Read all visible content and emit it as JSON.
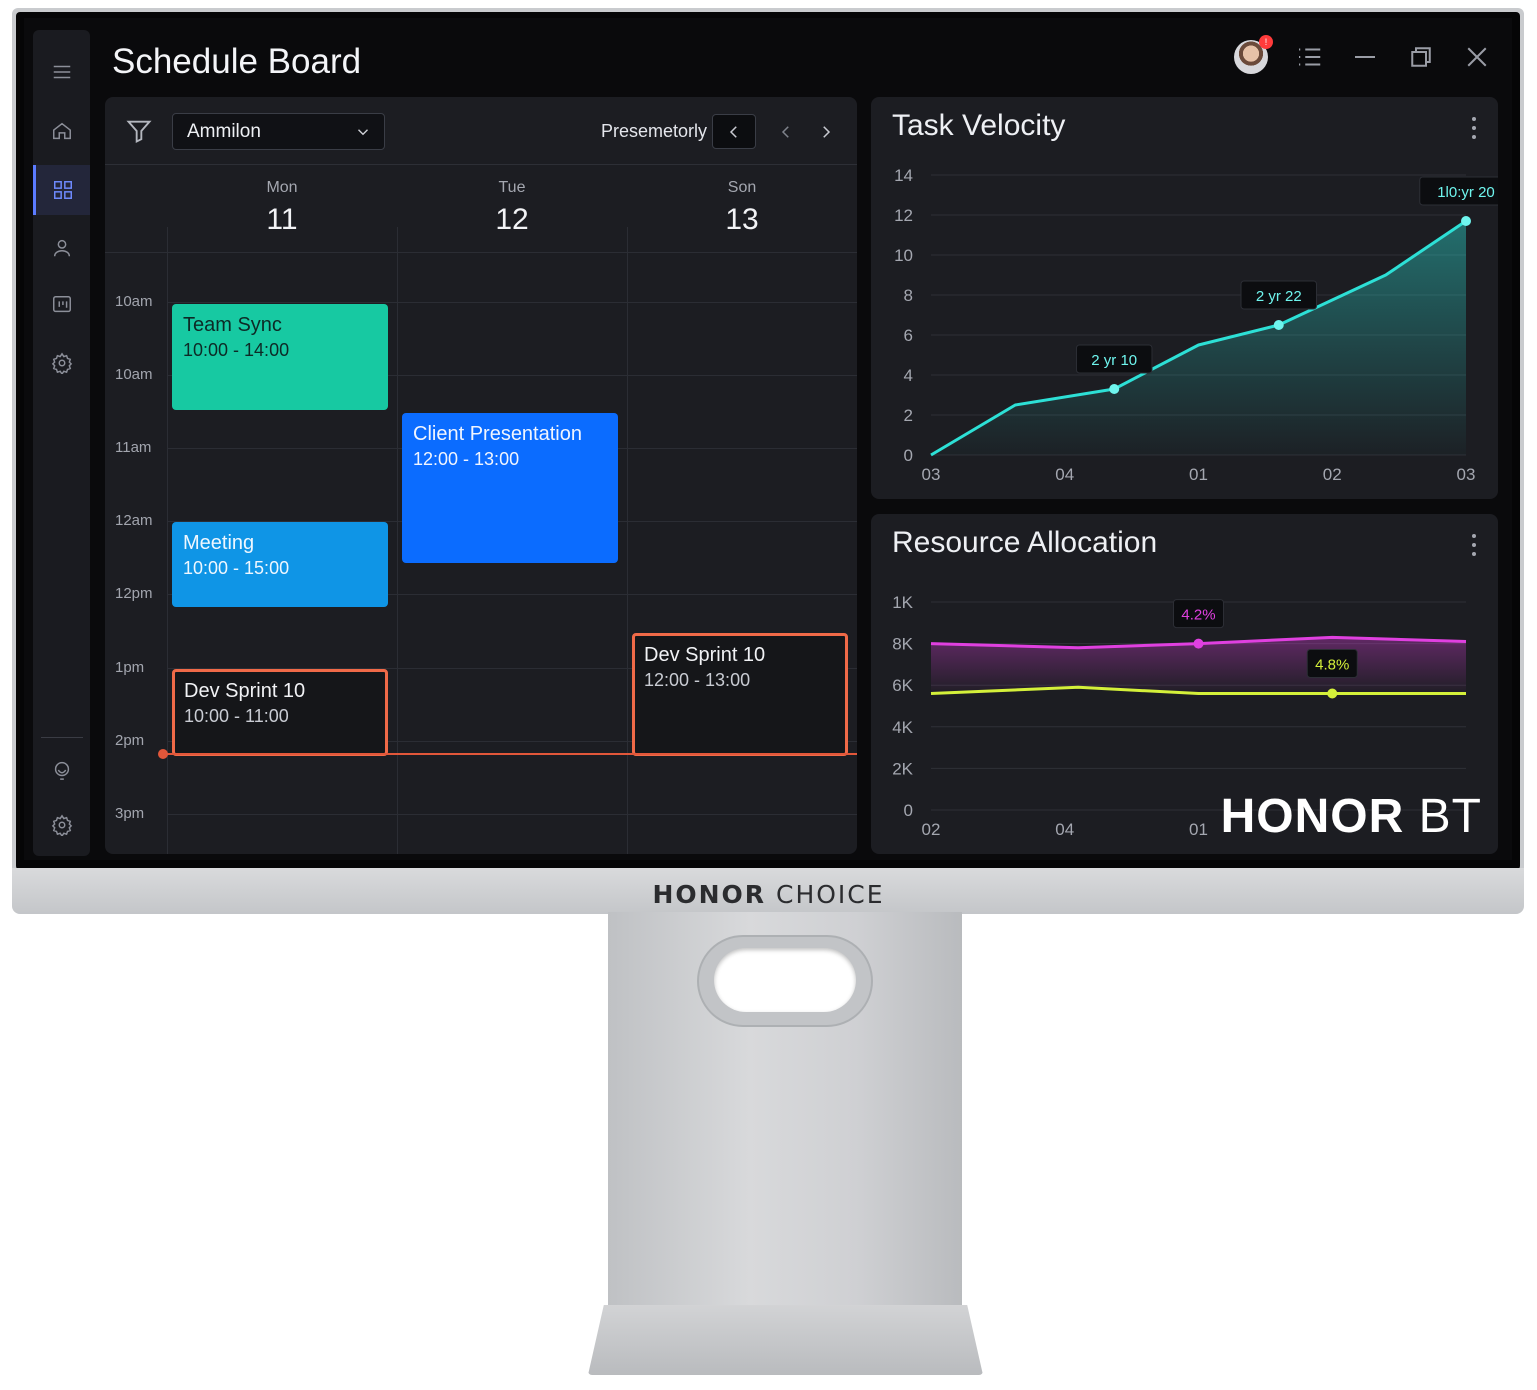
{
  "app": {
    "title": "Schedule Board",
    "notification_count": "!",
    "watermark_brand": "HONOR",
    "watermark_model": "BT"
  },
  "device": {
    "brand": "HONOR",
    "model": "CHOICE"
  },
  "sidebar": {
    "items": [
      {
        "name": "menu",
        "icon": "hamburger-icon"
      },
      {
        "name": "home",
        "icon": "home-icon"
      },
      {
        "name": "dashboard",
        "icon": "grid-icon",
        "active": true
      },
      {
        "name": "profile",
        "icon": "user-icon"
      },
      {
        "name": "reports",
        "icon": "chart-board-icon"
      },
      {
        "name": "settings",
        "icon": "gear-icon"
      },
      {
        "name": "support",
        "icon": "headset-icon"
      },
      {
        "name": "preferences",
        "icon": "gear-icon"
      }
    ]
  },
  "calendar": {
    "filter_value": "Ammilon",
    "period_label": "Presemetorly",
    "days": [
      {
        "name": "Mon",
        "num": "11"
      },
      {
        "name": "Tue",
        "num": "12"
      },
      {
        "name": "Son",
        "num": "13"
      }
    ],
    "time_labels": [
      "10am",
      "10am",
      "11am",
      "12am",
      "12pm",
      "1pm",
      "2pm",
      "3pm"
    ],
    "events": [
      {
        "title": "Team Sync",
        "time": "10:00 - 14:00",
        "style": "teal"
      },
      {
        "title": "Meeting",
        "time": "10:00 - 15:00",
        "style": "cyan"
      },
      {
        "title": "Dev Sprint 10",
        "time": "10:00 - 11:00",
        "style": "outline"
      },
      {
        "title": "Client Presentation",
        "time": "12:00 - 13:00",
        "style": "blue"
      },
      {
        "title": "Dev Sprint 10",
        "time": "12:00 - 13:00",
        "style": "outline"
      }
    ]
  },
  "task_velocity": {
    "title": "Task Velocity",
    "chart_data": {
      "type": "area",
      "x_tick_labels": [
        "03",
        "04",
        "01",
        "02",
        "03"
      ],
      "y_ticks": [
        0,
        2,
        4,
        6,
        8,
        10,
        12,
        14
      ],
      "ylim": [
        0,
        14
      ],
      "series": [
        {
          "color": "#2de0d6",
          "points": [
            [
              0,
              0
            ],
            [
              0.63,
              2.5
            ],
            [
              1.37,
              3.3
            ],
            [
              2.0,
              5.5
            ],
            [
              2.6,
              6.5
            ],
            [
              3.4,
              9.0
            ],
            [
              4.0,
              11.7
            ]
          ]
        }
      ],
      "annotations": [
        {
          "label": "2 yr 10",
          "x": 1.37,
          "y": 3.3
        },
        {
          "label": "2 yr 22",
          "x": 2.6,
          "y": 6.5
        },
        {
          "label": "1l0:yr 20",
          "x": 4.0,
          "y": 11.7
        }
      ]
    }
  },
  "resource_allocation": {
    "title": "Resource Allocation",
    "chart_data": {
      "type": "line",
      "x_tick_labels": [
        "02",
        "04",
        "01"
      ],
      "y_tick_labels": [
        "0",
        "2K",
        "4K",
        "6K",
        "8K",
        "1K"
      ],
      "y_ticks": [
        0,
        2,
        4,
        6,
        8,
        10
      ],
      "ylim": [
        0,
        10
      ],
      "series": [
        {
          "color": "#e040e0",
          "points": [
            [
              0,
              8.0
            ],
            [
              1.1,
              7.8
            ],
            [
              2.0,
              8.0
            ],
            [
              3.0,
              8.3
            ],
            [
              4.0,
              8.1
            ]
          ]
        },
        {
          "color": "#d4f03a",
          "points": [
            [
              0,
              5.6
            ],
            [
              1.1,
              5.9
            ],
            [
              2.0,
              5.6
            ],
            [
              3.0,
              5.6
            ],
            [
              4.0,
              5.6
            ]
          ]
        }
      ],
      "annotations": [
        {
          "label": "4.2%",
          "x": 2.0,
          "y": 8.0,
          "color": "#e040e0"
        },
        {
          "label": "4.8%",
          "x": 3.0,
          "y": 5.6,
          "color": "#d4f03a"
        }
      ]
    }
  }
}
